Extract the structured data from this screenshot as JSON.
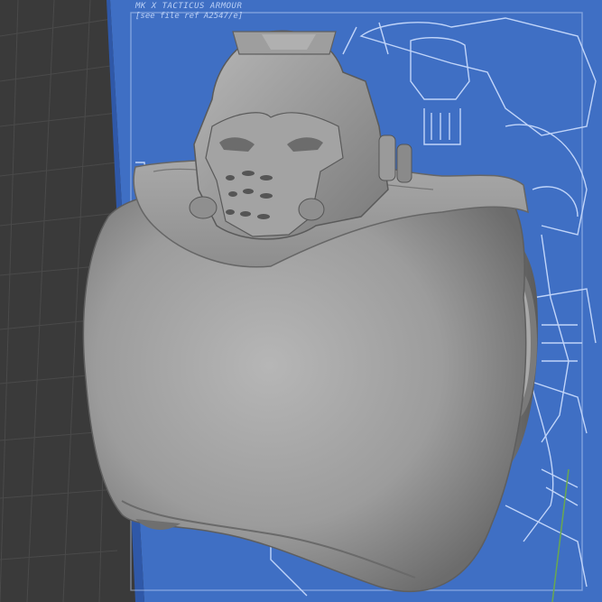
{
  "viewport": {
    "reference_image": {
      "caption_line1": "MK X TACTICUS ARMOUR",
      "caption_line2": "[see file ref A2547/e]"
    },
    "model": {
      "name": "",
      "shading": "solid"
    },
    "colors": {
      "grid_background": "#3a3a3a",
      "blueprint_blue": "#3f6fc4",
      "blueprint_lines": "#cfe0ff",
      "model_gray": "#9a9a9a",
      "axis_green": "#6aa84f"
    }
  }
}
